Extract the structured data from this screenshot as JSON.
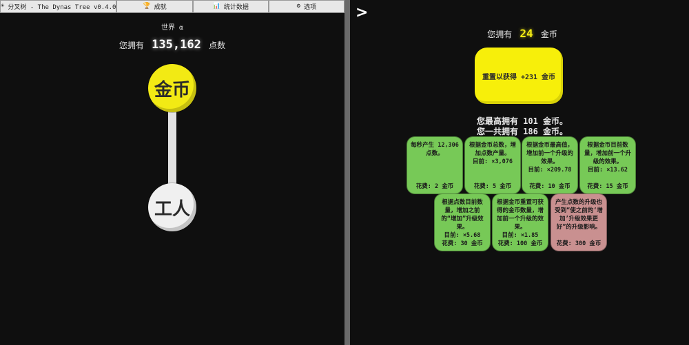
{
  "tabs": [
    {
      "icon": "☀",
      "label": "分叉树 - The Dynas Tree v0.4.0"
    },
    {
      "icon": "🏆",
      "label": "成就"
    },
    {
      "icon": "📊",
      "label": "统计数据"
    },
    {
      "icon": "⚙",
      "label": "选项"
    }
  ],
  "world": "世界 α",
  "points": {
    "prefix": "您拥有",
    "value": "135,162",
    "suffix": "点数"
  },
  "tree": {
    "coin_node": "金币",
    "worker_node": "工人"
  },
  "back_label": ">",
  "layer": {
    "prefix": "您拥有",
    "coins": "24",
    "suffix": "金币",
    "reset_label": "重置以获得 +231 金币",
    "best": "您最高拥有 101 金币。",
    "total": "您一共拥有 186 金币。"
  },
  "upgrades": [
    {
      "desc": "每秒产生 12,306 点数。",
      "current": "",
      "cost": "花费: 2 金币",
      "state": "bought"
    },
    {
      "desc": "根据金币总数，增加点数产量。",
      "current": "目前: ×3,076",
      "cost": "花费: 5 金币",
      "state": "bought"
    },
    {
      "desc": "根据金币最高值，增加前一个升级的效果。",
      "current": "目前: ×209.78",
      "cost": "花费: 10 金币",
      "state": "bought"
    },
    {
      "desc": "根据金币目前数量，增加前一个升级的效果。",
      "current": "目前: ×13.62",
      "cost": "花费: 15 金币",
      "state": "bought"
    },
    {
      "desc": "根据点数目前数量，增加之前的“增加”升级效果。",
      "current": "目前: ×5.68",
      "cost": "花费: 30 金币",
      "state": "bought"
    },
    {
      "desc": "根据金币重置可获得的金币数量，增加前一个升级的效果。",
      "current": "目前: ×1.85",
      "cost": "花费: 100 金币",
      "state": "bought"
    },
    {
      "desc": "产生点数的升级也受到“使之前的‘增加’升级效果更好”的升级影响。",
      "current": "",
      "cost": "花费: 300 金币",
      "state": "locked"
    }
  ],
  "colors": {
    "coin": "#f2ea14",
    "bought": "#77c957",
    "locked": "#c99090",
    "background": "#0f0f0f"
  }
}
